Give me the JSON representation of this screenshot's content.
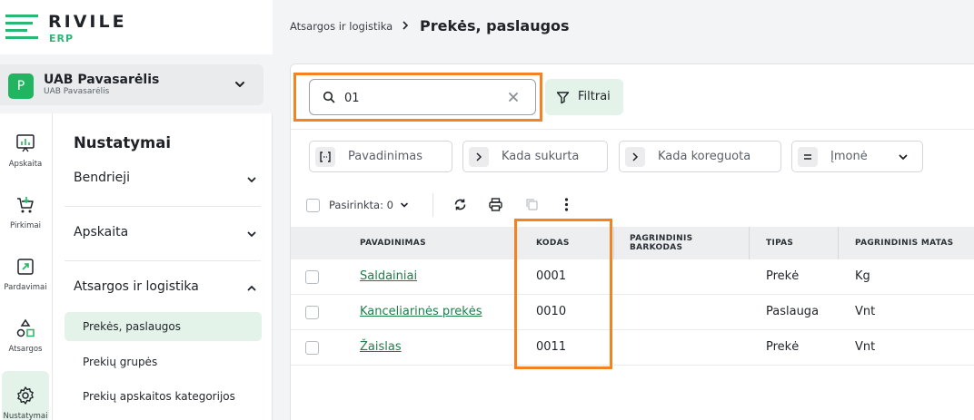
{
  "brand": {
    "name": "RIVILE",
    "sub": "ERP"
  },
  "company": {
    "badge": "P",
    "name": "UAB Pavasarėlis",
    "sub": "UAB Pavasarėlis"
  },
  "rail": [
    {
      "label": "Apskaita",
      "icon": "chart-icon"
    },
    {
      "label": "Pirkimai",
      "icon": "cart-icon"
    },
    {
      "label": "Pardavimai",
      "icon": "sales-icon"
    },
    {
      "label": "Atsargos",
      "icon": "shapes-icon"
    },
    {
      "label": "Nustatymai",
      "icon": "gear-icon"
    }
  ],
  "menu": {
    "title": "Nustatymai",
    "sections": [
      "Bendrieji",
      "Apskaita",
      "Atsargos ir logistika"
    ],
    "sub_items": [
      "Prekės, paslaugos",
      "Prekių grupės",
      "Prekių apskaitos kategorijos"
    ]
  },
  "breadcrumb": {
    "parent": "Atsargos ir logistika",
    "current": "Prekės, paslaugos"
  },
  "search": {
    "value": "01",
    "placeholder": ""
  },
  "filter_label": "Filtrai",
  "chips": [
    "Pavadinimas",
    "Kada sukurta",
    "Kada koreguota",
    "Įmonė"
  ],
  "selection": {
    "label": "Pasirinkta: 0"
  },
  "table": {
    "headers": [
      "PAVADINIMAS",
      "KODAS",
      "PAGRINDINIS BARKODAS",
      "TIPAS",
      "PAGRINDINIS MATAS"
    ],
    "rows": [
      {
        "name": "Saldainiai",
        "code": "0001",
        "barcode": "",
        "type": "Prekė",
        "unit": "Kg"
      },
      {
        "name": "Kanceliarinės prekės",
        "code": "0010",
        "barcode": "",
        "type": "Paslauga",
        "unit": "Vnt"
      },
      {
        "name": "Žaislas",
        "code": "0011",
        "barcode": "",
        "type": "Prekė",
        "unit": "Vnt"
      }
    ]
  },
  "colors": {
    "accent": "#22b561",
    "link": "#1d7d4b",
    "highlight": "#f58220",
    "active_bg": "#e3f3ea"
  }
}
